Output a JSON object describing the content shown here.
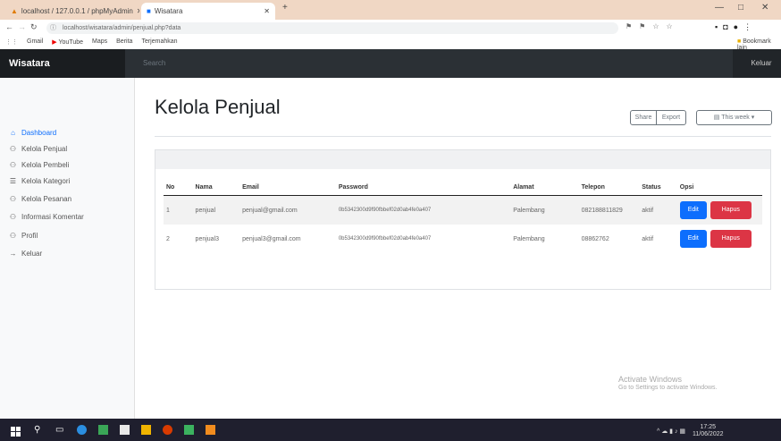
{
  "browser": {
    "tabs": [
      {
        "title": "localhost / 127.0.0.1 / phpMyAdmin"
      },
      {
        "title": "Wisatara"
      }
    ],
    "new_tab": "+",
    "url": "localhost/wisatara/admin/penjual.php?data",
    "bookmarks": [
      "Gmail",
      "YouTube",
      "Maps",
      "Berita",
      "Terjemahkan"
    ],
    "all_bookmarks": "Bookmark lain",
    "window_controls": [
      "—",
      "□",
      "✕"
    ]
  },
  "navbar": {
    "brand": "Wisatara",
    "search_placeholder": "Search",
    "signout": "Keluar"
  },
  "sidebar": {
    "items": [
      {
        "label": "Dashboard",
        "icon": "home-icon",
        "glyph": "⌂",
        "active": true
      },
      {
        "label": "Kelola Penjual",
        "icon": "user-icon",
        "glyph": "⚇",
        "active": false
      },
      {
        "label": "Kelola Pembeli",
        "icon": "users-icon",
        "glyph": "⚇",
        "active": false
      },
      {
        "label": "Kelola Kategori",
        "icon": "layers-icon",
        "glyph": "☰",
        "active": false
      },
      {
        "label": "Kelola Pesanan",
        "icon": "cart-icon",
        "glyph": "⚇",
        "active": false
      },
      {
        "label": "Informasi Komentar",
        "icon": "comment-icon",
        "glyph": "⚇",
        "active": false
      },
      {
        "label": "Profil",
        "icon": "profile-icon",
        "glyph": "⚇",
        "active": false
      },
      {
        "label": "Keluar",
        "icon": "logout-icon",
        "glyph": "→",
        "active": false
      }
    ]
  },
  "page": {
    "title": "Kelola Penjual",
    "share_label": "Share",
    "export_label": "Export",
    "period_label": "This week"
  },
  "table": {
    "headers": [
      "No",
      "Nama",
      "Email",
      "Password",
      "Alamat",
      "Telepon",
      "Status",
      "Opsi"
    ],
    "rows": [
      {
        "no": "1",
        "nama": "penjual",
        "email": "penjual@gmail.com",
        "password": "0b5342300d9f90fbbef02d0ab4fe0a407",
        "alamat": "Palembang",
        "telepon": "082188811829",
        "status": "aktif"
      },
      {
        "no": "2",
        "nama": "penjual3",
        "email": "penjual3@gmail.com",
        "password": "0b5342300d9f90fbbef02d0ab4fe0a407",
        "alamat": "Palembang",
        "telepon": "08862762",
        "status": "aktif"
      }
    ],
    "edit_label": "Edit",
    "delete_label": "Hapus"
  },
  "watermark": {
    "line1": "Activate Windows",
    "line2": "Go to Settings to activate Windows."
  },
  "taskbar": {
    "time": "17:25",
    "date": "11/06/2022"
  },
  "colors": {
    "primary": "#0d6efd",
    "danger": "#dc3545",
    "navbar": "#212529",
    "tabbar": "#f0d7c4"
  }
}
